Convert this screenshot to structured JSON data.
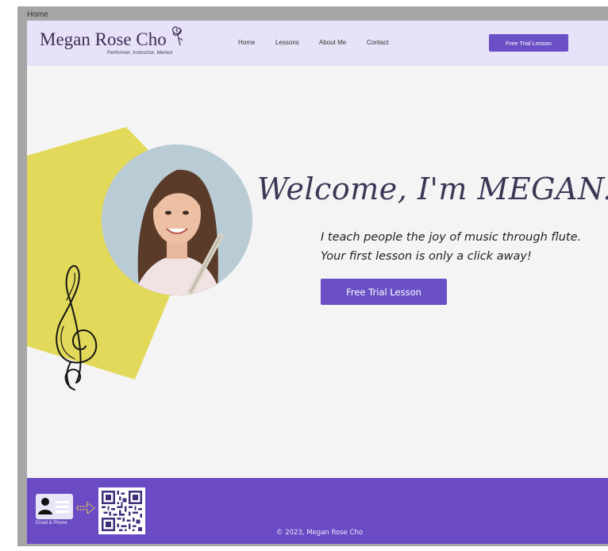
{
  "frame": {
    "label": "Home"
  },
  "header": {
    "brand_name": "Megan Rose Cho",
    "tagline": "Performer, Instructor, Mentor",
    "nav": [
      "Home",
      "Lessons",
      "About Me",
      "Contact"
    ],
    "cta_label": "Free Trial Lesson"
  },
  "hero": {
    "heading": "Welcome, I'm MEGAN.",
    "tagline_line1": "I teach people the joy of music through flute.",
    "tagline_line2": "Your first lesson is only a click away!",
    "cta_label": "Free Trial Lesson"
  },
  "footer": {
    "contact_caption": "Email & Phone",
    "copyright": "© 2023, Megan Rose Cho"
  },
  "colors": {
    "accent": "#6b4fc6",
    "header_bg": "#e7e2f7",
    "footer_bg": "#6a4bc4",
    "shape_yellow": "#e2d95a",
    "page_bg": "#f4f4f5"
  },
  "icons": [
    "rose-icon",
    "treble-clef-icon",
    "contact-card-icon",
    "arrow-icon",
    "qr-code-icon",
    "portrait-photo"
  ]
}
